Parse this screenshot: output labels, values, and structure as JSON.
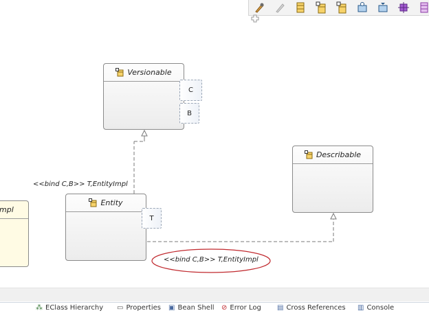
{
  "palette": {
    "tools": [
      {
        "icon": "select-tool-icon"
      },
      {
        "icon": "marquee-tool-icon"
      },
      {
        "icon": "class-tool-icon"
      },
      {
        "icon": "abstract-class-tool-icon"
      },
      {
        "icon": "template-class-tool-icon"
      },
      {
        "icon": "interface-tool-icon"
      },
      {
        "icon": "enumeration-tool-icon"
      },
      {
        "icon": "datatype-tool-icon"
      },
      {
        "icon": "component-tool-icon"
      }
    ]
  },
  "diagram": {
    "nodes": {
      "versionable": {
        "name": "Versionable",
        "params": [
          "C",
          "B"
        ]
      },
      "entity": {
        "name": "Entity",
        "params": [
          "T"
        ]
      },
      "describable": {
        "name": "Describable"
      },
      "partial": {
        "name": "mpl"
      }
    },
    "labels": {
      "versionable_binding": "<<bind C,B>> T,EntityImpl",
      "describable_binding": "<<bind C,B>> T,EntityImpl"
    },
    "highlight_color": "#c0282d"
  },
  "bottom_tabs": [
    {
      "label": "EClass Hierarchy",
      "icon": "hierarchy-icon"
    },
    {
      "label": "Properties",
      "icon": "properties-icon"
    },
    {
      "label": "Bean Shell",
      "icon": "console-icon"
    },
    {
      "label": "Error Log",
      "icon": "error-log-icon"
    },
    {
      "label": "Cross References",
      "icon": "references-icon"
    },
    {
      "label": "Console",
      "icon": "console-view-icon"
    }
  ]
}
